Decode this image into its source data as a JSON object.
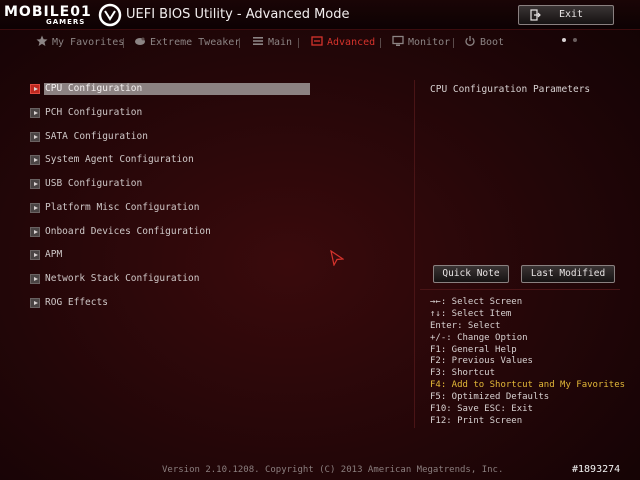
{
  "header": {
    "logo_main": "MOBILE01",
    "logo_sub": "GAMERS",
    "title": "UEFI BIOS Utility - Advanced Mode",
    "exit_label": "Exit"
  },
  "tabs": [
    {
      "label": "My Favorites",
      "icon": "star-icon",
      "active": false
    },
    {
      "label": "Extreme Tweaker",
      "icon": "tweaker-icon",
      "active": false
    },
    {
      "label": "Main",
      "icon": "list-icon",
      "active": false
    },
    {
      "label": "Advanced",
      "icon": "advanced-icon",
      "active": true
    },
    {
      "label": "Monitor",
      "icon": "monitor-icon",
      "active": false
    },
    {
      "label": "Boot",
      "icon": "power-icon",
      "active": false
    }
  ],
  "menu": {
    "items": [
      {
        "label": "CPU Configuration",
        "selected": true
      },
      {
        "label": "PCH Configuration",
        "selected": false
      },
      {
        "label": "SATA Configuration",
        "selected": false
      },
      {
        "label": "System Agent Configuration",
        "selected": false
      },
      {
        "label": "USB Configuration",
        "selected": false
      },
      {
        "label": "Platform Misc Configuration",
        "selected": false
      },
      {
        "label": "Onboard Devices Configuration",
        "selected": false
      },
      {
        "label": "APM",
        "selected": false
      },
      {
        "label": "Network Stack Configuration",
        "selected": false
      },
      {
        "label": "ROG Effects",
        "selected": false
      }
    ]
  },
  "help": {
    "title": "CPU Configuration Parameters",
    "quick_note": "Quick Note",
    "last_modified": "Last Modified",
    "keys": [
      {
        "text": "→←: Select Screen",
        "highlight": false
      },
      {
        "text": "↑↓: Select Item",
        "highlight": false
      },
      {
        "text": "Enter: Select",
        "highlight": false
      },
      {
        "text": "+/-: Change Option",
        "highlight": false
      },
      {
        "text": "F1: General Help",
        "highlight": false
      },
      {
        "text": "F2: Previous Values",
        "highlight": false
      },
      {
        "text": "F3: Shortcut",
        "highlight": false
      },
      {
        "text": "F4: Add to Shortcut and My Favorites",
        "highlight": true
      },
      {
        "text": "F5: Optimized Defaults",
        "highlight": false
      },
      {
        "text": "F10: Save  ESC: Exit",
        "highlight": false
      },
      {
        "text": "F12: Print Screen",
        "highlight": false
      }
    ]
  },
  "footer": {
    "version": "Version 2.10.1208. Copyright (C) 2013 American Megatrends, Inc.",
    "watermark": "#1893274"
  },
  "colors": {
    "accent": "#d6332c",
    "background": "#230608",
    "highlight_key": "#e3b838"
  }
}
